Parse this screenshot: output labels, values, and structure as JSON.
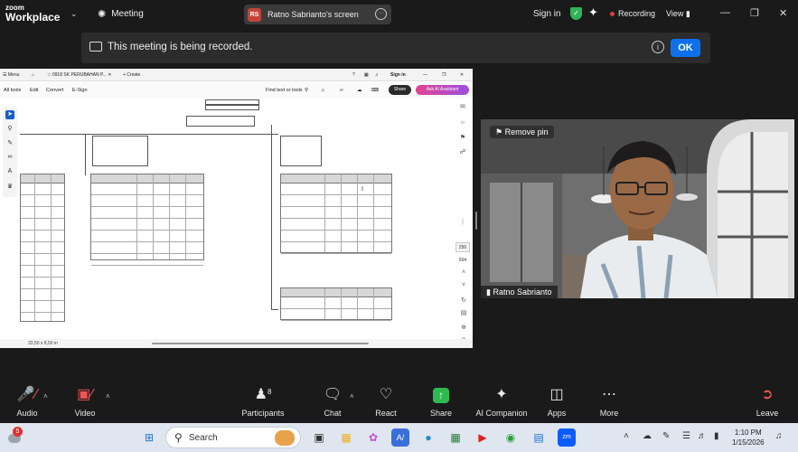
{
  "app": {
    "logo_top": "zoom",
    "logo_bottom": "Workplace",
    "meeting_label": "Meeting"
  },
  "share": {
    "initials": "RS",
    "title": "Ratno Sabrianto's screen"
  },
  "header": {
    "signin": "Sign in",
    "recording": "Recording",
    "view": "View"
  },
  "notice": {
    "message": "This meeting is being recorded.",
    "ok": "OK"
  },
  "pdf": {
    "menu": "Menu",
    "tab_title": "0918 SK PERUBAHAN P...",
    "new_tab": "+ Create",
    "signin": "Sign in",
    "toolbar": [
      "All tools",
      "Edit",
      "Convert",
      "E-Sign"
    ],
    "find": "Find text or tools",
    "share": "Share",
    "ai": "Ask AI Assistant",
    "page_current": "250",
    "page_total": "564",
    "dimensions": "33,50 x 8,50 in"
  },
  "video": {
    "remove_pin": "Remove pin",
    "participant": "Ratno Sabrianto"
  },
  "toolbar": {
    "audio": "Audio",
    "video": "Video",
    "participants": "Participants",
    "participants_count": "8",
    "chat": "Chat",
    "react": "React",
    "share": "Share",
    "ai": "AI Companion",
    "apps": "Apps",
    "more": "More",
    "leave": "Leave"
  },
  "taskbar": {
    "search": "Search",
    "time": "1:10 PM",
    "date": "1/15/2026",
    "weather_badge": "5"
  }
}
